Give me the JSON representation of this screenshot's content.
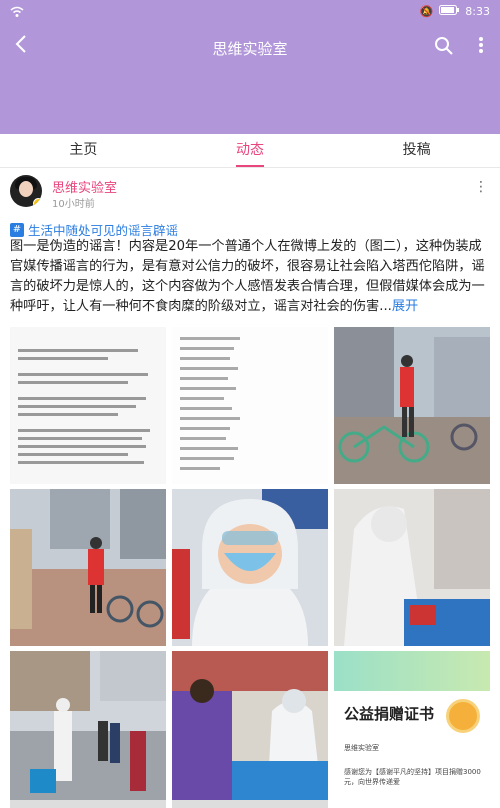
{
  "status": {
    "time": "8:33"
  },
  "appbar": {
    "title": "思维实验室"
  },
  "tabs": [
    {
      "label": "主页"
    },
    {
      "label": "动态"
    },
    {
      "label": "投稿"
    }
  ],
  "post": {
    "author": "思维实验室",
    "time": "10小时前",
    "topic": "生活中随处可见的谣言辟谣",
    "text": "图一是伪造的谣言！内容是20年一个普通个人在微博上发的（图二），这种伪装成官媒传播谣言的行为，是有意对公信力的破坏，很容易让社会陷入塔西佗陷阱，谣言的破坏力是惊人的，这个内容做为个人感悟发表合情合理，但假借媒体会成为一种呼吁，让人有一种何不食肉糜的阶级对立，谣言对社会的伤害...",
    "expand": "展开"
  },
  "certificate": {
    "title": "公益捐赠证书",
    "org": "思维实验室",
    "desc": "感谢您为【感谢平凡的坚持】项目捐赠3000元，向世界传递爱"
  },
  "colors": {
    "accent": "#e8467c",
    "appbar": "#b197d9",
    "link": "#2a7de1"
  }
}
